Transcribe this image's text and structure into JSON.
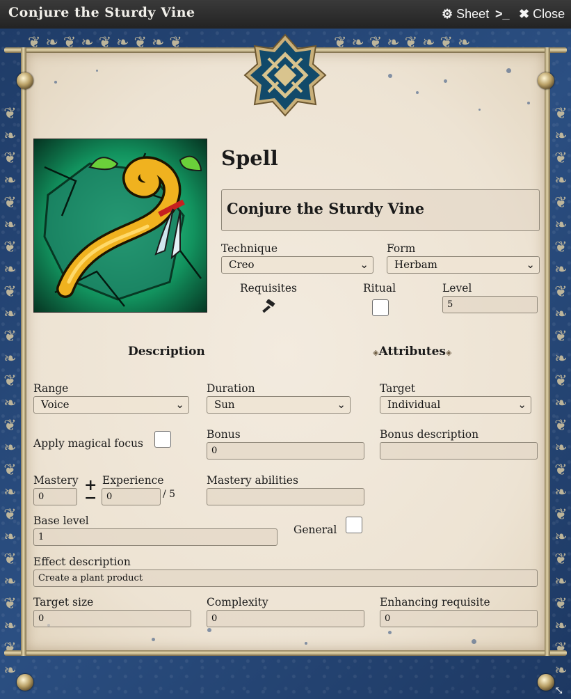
{
  "window": {
    "title": "Conjure the Sturdy Vine",
    "sheet_label": "Sheet",
    "close_label": "Close"
  },
  "page_heading": "Spell",
  "spell": {
    "name": "Conjure the Sturdy Vine",
    "technique_label": "Technique",
    "technique_value": "Creo",
    "form_label": "Form",
    "form_value": "Herbam",
    "requisites_label": "Requisites",
    "ritual_label": "Ritual",
    "level_label": "Level",
    "level_value": "5"
  },
  "sections": {
    "description": "Description",
    "attributes": "Attributes"
  },
  "fields": {
    "range_label": "Range",
    "range_value": "Voice",
    "duration_label": "Duration",
    "duration_value": "Sun",
    "target_label": "Target",
    "target_value": "Individual",
    "apply_focus_label": "Apply magical focus",
    "bonus_label": "Bonus",
    "bonus_value": "0",
    "bonus_desc_label": "Bonus description",
    "bonus_desc_value": "",
    "mastery_label": "Mastery",
    "mastery_value": "0",
    "plus": "+",
    "minus": "−",
    "experience_label": "Experience",
    "experience_value": "0",
    "experience_max": "/ 5",
    "mastery_abilities_label": "Mastery abilities",
    "mastery_abilities_value": "",
    "base_level_label": "Base level",
    "base_level_value": "1",
    "general_label": "General",
    "effect_desc_label": "Effect description",
    "effect_desc_value": "Create a plant product",
    "target_size_label": "Target size",
    "target_size_value": "0",
    "complexity_label": "Complexity",
    "complexity_value": "0",
    "enhancing_label": "Enhancing requisite",
    "enhancing_value": "0"
  },
  "icons": {
    "sheet": "gear-icon",
    "terminal": "terminal-icon",
    "close": "close-icon",
    "requisites": "hammer-icon",
    "select": "chevron-down-icon",
    "resize": "resize-icon"
  },
  "colors": {
    "titlebar": "#2b2b2b",
    "frame_blue": "#23426e",
    "parchment": "#efe6d8",
    "gold_rail": "#d8c9a2"
  }
}
